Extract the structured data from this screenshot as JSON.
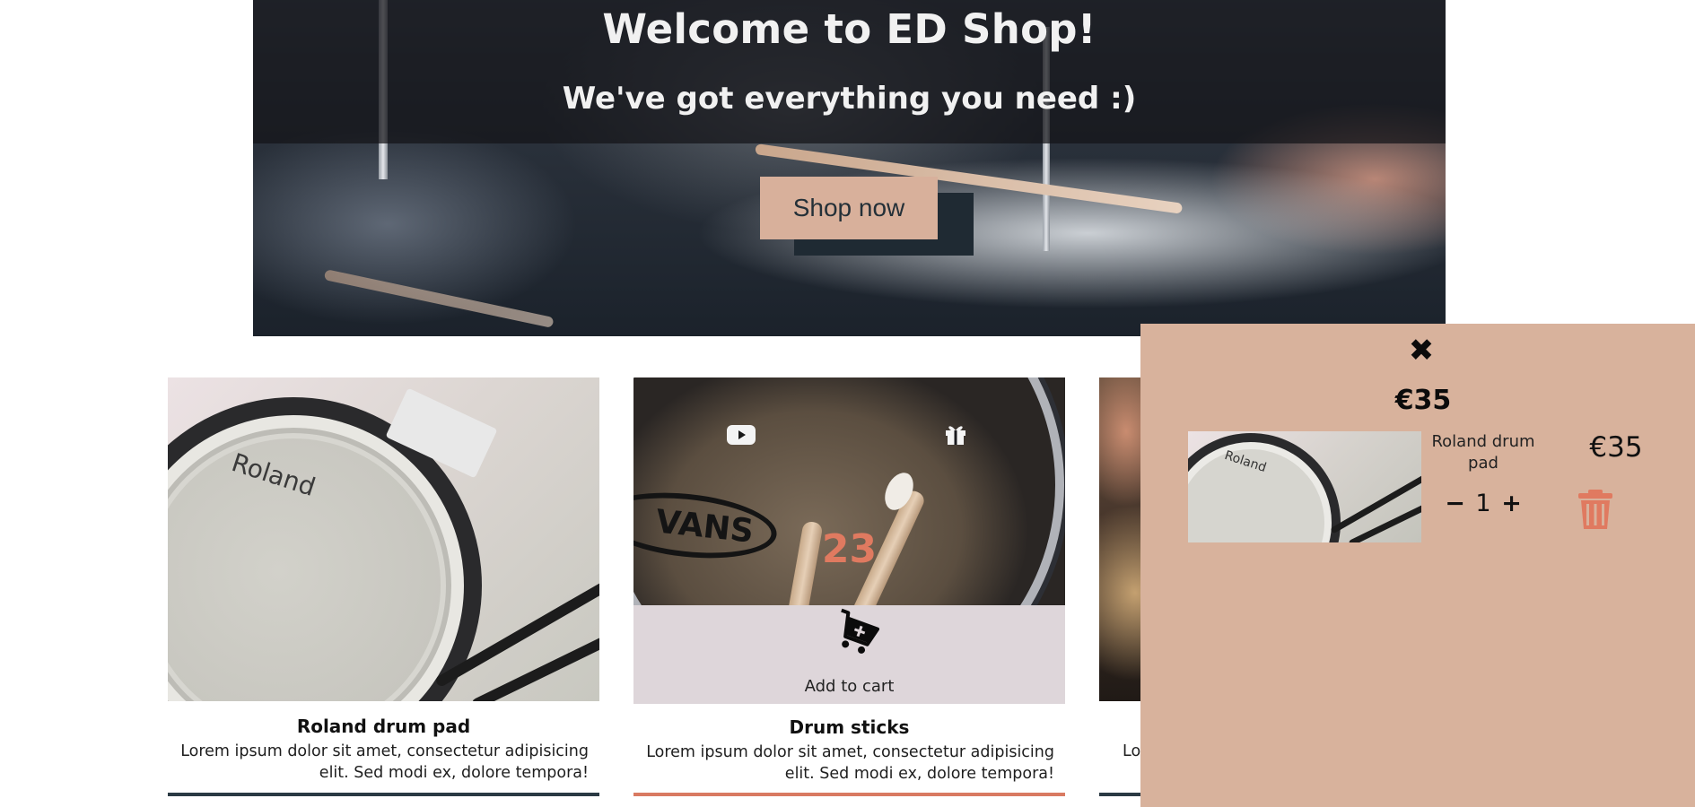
{
  "hero": {
    "title": "Welcome to ED Shop!",
    "subtitle": "We've got everything you need :)",
    "cta_label": "Shop now"
  },
  "products": [
    {
      "name": "Roland drum pad",
      "description": "Lorem ipsum dolor sit amet, consectetur adipisicing elit. Sed modi ex, dolore tempora!",
      "image_text": "Roland"
    },
    {
      "name": "Drum sticks",
      "description": "Lorem ipsum dolor sit amet, consectetur adipisicing elit. Sed modi ex, dolore tempora!",
      "image_text": "VANS",
      "counter": "23",
      "add_to_cart_label": "Add to cart",
      "icons": [
        "youtube-icon",
        "gift-icon",
        "add-to-cart-icon"
      ]
    },
    {
      "description_fragment": "Lo"
    }
  ],
  "cart": {
    "close_symbol": "✖",
    "total": "€35",
    "items": [
      {
        "name": "Roland drum pad",
        "thumb_text": "Roland",
        "quantity": "1",
        "decrement_symbol": "−",
        "increment_symbol": "+",
        "price": "€35"
      }
    ]
  },
  "colors": {
    "accent": "#e07a60",
    "drawer_bg": "#d8b29c",
    "cta_bg": "#d8b09b",
    "cart_panel_bg": "#ded6da",
    "rule_dark": "#2b3a44",
    "rule_accent": "#d97a62"
  }
}
